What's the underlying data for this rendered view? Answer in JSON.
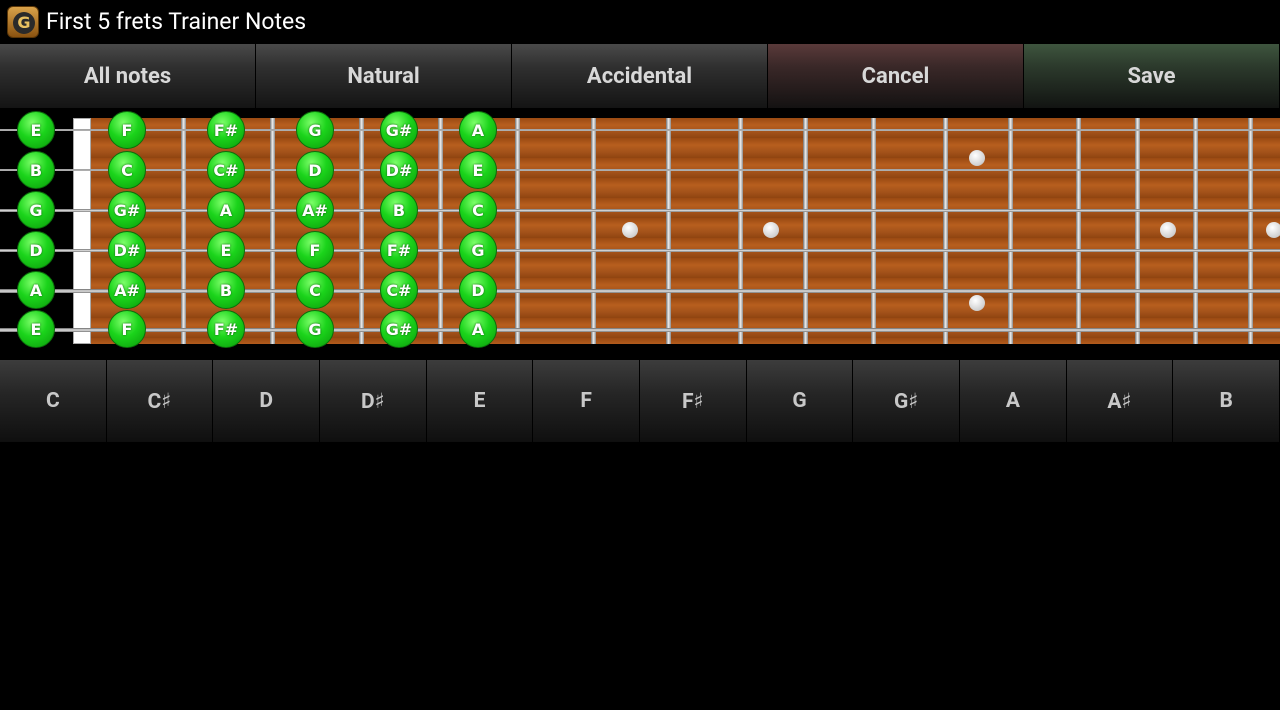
{
  "app": {
    "title": "First 5 frets Trainer Notes",
    "icon": "guitar-app-icon",
    "icon_letter": "G"
  },
  "toolbar": {
    "all_notes": "All notes",
    "natural": "Natural",
    "accidental": "Accidental",
    "cancel": "Cancel",
    "save": "Save"
  },
  "fretboard": {
    "open_strings": [
      "E",
      "B",
      "G",
      "D",
      "A",
      "E"
    ],
    "frets": [
      [
        "F",
        "C",
        "G#",
        "D#",
        "A#",
        "F"
      ],
      [
        "F#",
        "C#",
        "A",
        "E",
        "B",
        "F#"
      ],
      [
        "G",
        "D",
        "A#",
        "F",
        "C",
        "G"
      ],
      [
        "G#",
        "D#",
        "B",
        "F#",
        "C#",
        "G#"
      ],
      [
        "A",
        "E",
        "C",
        "G",
        "D",
        "A"
      ]
    ]
  },
  "note_buttons": [
    "C",
    "C♯",
    "D",
    "D♯",
    "E",
    "F",
    "F♯",
    "G",
    "G♯",
    "A",
    "A♯",
    "B"
  ],
  "colors": {
    "note_green": "#19d019",
    "wood": "#a6541a",
    "background": "#000000"
  }
}
